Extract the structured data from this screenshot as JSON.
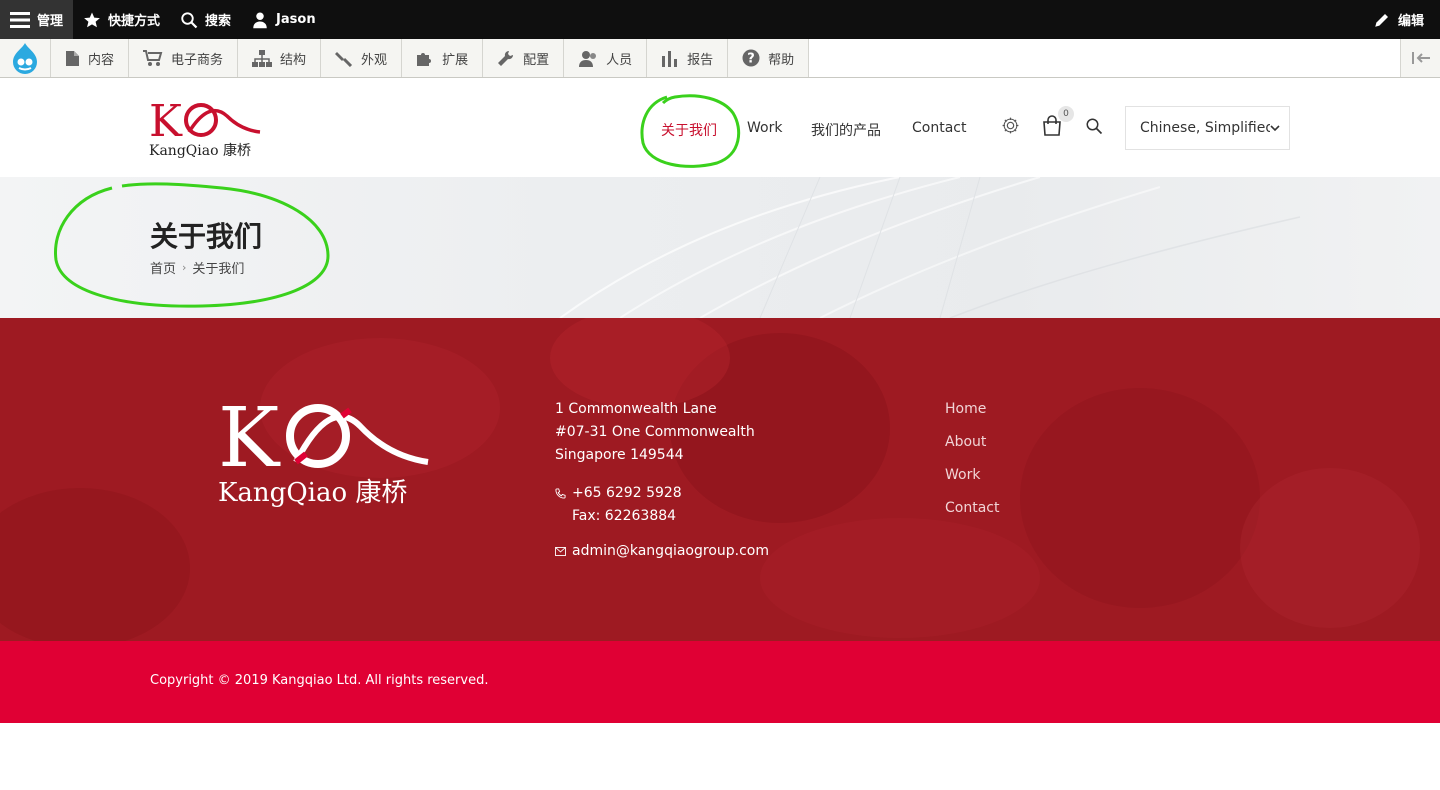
{
  "admin_bar": {
    "manage": "管理",
    "shortcuts": "快捷方式",
    "search": "搜索",
    "user": "Jason",
    "edit": "编辑"
  },
  "admin_tray": {
    "items": [
      {
        "label": "内容",
        "icon": "file-icon"
      },
      {
        "label": "电子商务",
        "icon": "cart-icon"
      },
      {
        "label": "结构",
        "icon": "sitemap-icon"
      },
      {
        "label": "外观",
        "icon": "brush-icon"
      },
      {
        "label": "扩展",
        "icon": "puzzle-icon"
      },
      {
        "label": "配置",
        "icon": "wrench-icon"
      },
      {
        "label": "人员",
        "icon": "people-icon"
      },
      {
        "label": "报告",
        "icon": "bar-chart-icon"
      },
      {
        "label": "帮助",
        "icon": "help-icon"
      }
    ]
  },
  "header": {
    "logo_text": "KangQiao 康桥",
    "nav": [
      "关于我们",
      "Work",
      "我们的产品",
      "Contact"
    ],
    "active_nav": "关于我们",
    "cart_count": "0",
    "language": "Chinese, Simplified"
  },
  "title_band": {
    "title": "关于我们",
    "breadcrumb": [
      "首页",
      "关于我们"
    ],
    "separator": "›"
  },
  "footer": {
    "logo_text": "KangQiao 康桥",
    "address": [
      "1 Commonwealth Lane",
      "#07-31 One Commonwealth",
      "Singapore 149544"
    ],
    "phone": "+65 6292 5928",
    "fax": "Fax: 62263884",
    "email": "admin@kangqiaogroup.com",
    "links": [
      "Home",
      "About",
      "Work",
      "Contact"
    ],
    "copyright": "Copyright © 2019 Kangqiao Ltd. All rights reserved."
  },
  "colors": {
    "brand_red": "#c8102e",
    "footer_bg": "#9e1a22",
    "copyright_bg": "#e00034",
    "annotation_green": "#3ad11c"
  }
}
